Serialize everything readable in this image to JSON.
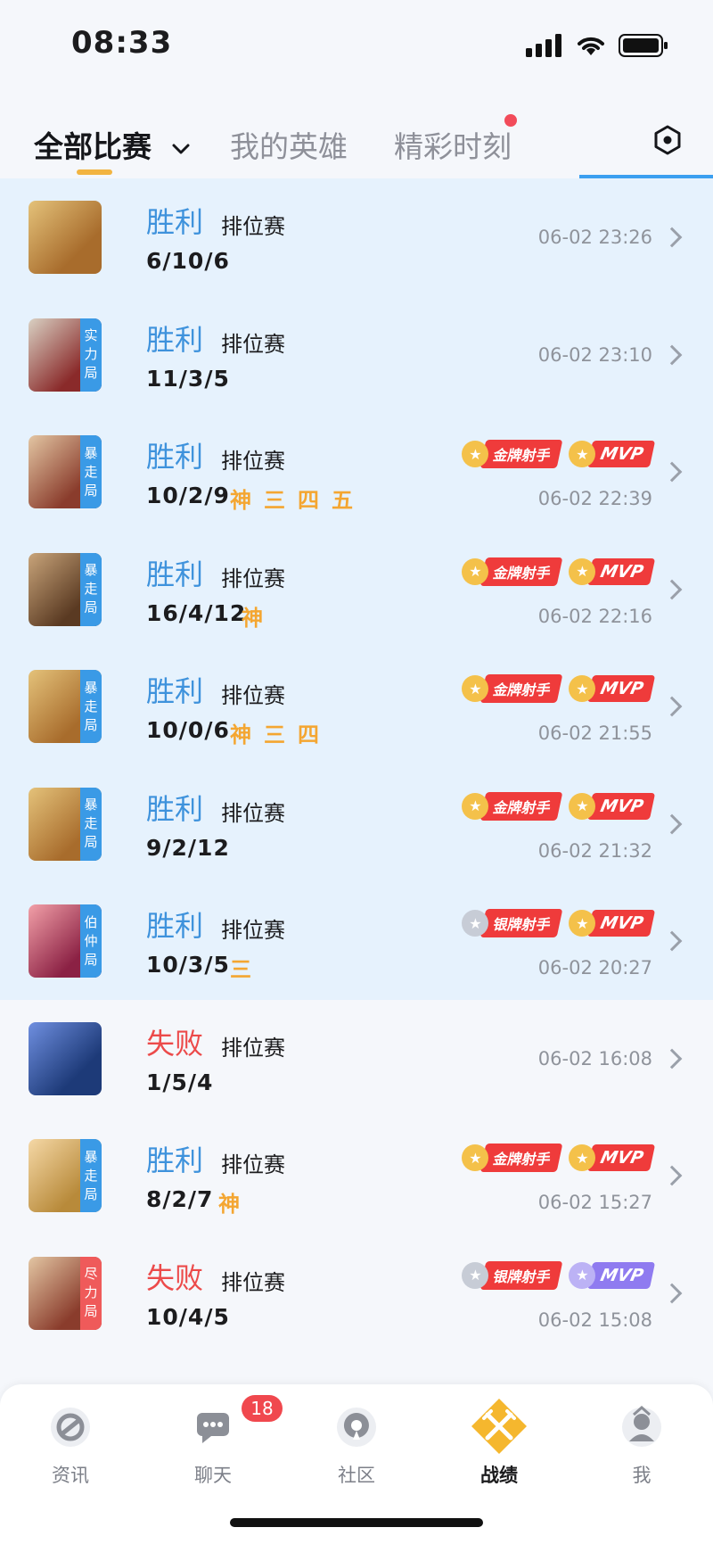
{
  "status_bar": {
    "time": "08:33"
  },
  "tabs": [
    {
      "label": "全部比赛",
      "active": true
    },
    {
      "label": "我的英雄",
      "active": false
    },
    {
      "label": "精彩时刻",
      "active": false
    }
  ],
  "matches": [
    {
      "result": "胜利",
      "outcome": "win",
      "mode": "排位赛",
      "kda": "6/10/6",
      "time": "06-02 23:26",
      "tag": "",
      "tag_color": "",
      "streaks": [],
      "badges": []
    },
    {
      "result": "胜利",
      "outcome": "win",
      "mode": "排位赛",
      "kda": "11/3/5",
      "time": "06-02 23:10",
      "tag": "实力局",
      "tag_color": "blue",
      "streaks": [],
      "badges": []
    },
    {
      "result": "胜利",
      "outcome": "win",
      "mode": "排位赛",
      "kda": "10/2/9",
      "time": "06-02 22:39",
      "tag": "暴走局",
      "tag_color": "blue",
      "streaks": [
        "神",
        "三",
        "四",
        "五"
      ],
      "badges": [
        "金牌射手",
        "MVP"
      ]
    },
    {
      "result": "胜利",
      "outcome": "win",
      "mode": "排位赛",
      "kda": "16/4/12",
      "time": "06-02 22:16",
      "tag": "暴走局",
      "tag_color": "blue",
      "streaks": [
        "神"
      ],
      "badges": [
        "金牌射手",
        "MVP"
      ]
    },
    {
      "result": "胜利",
      "outcome": "win",
      "mode": "排位赛",
      "kda": "10/0/6",
      "time": "06-02 21:55",
      "tag": "暴走局",
      "tag_color": "blue",
      "streaks": [
        "神",
        "三",
        "四"
      ],
      "badges": [
        "金牌射手",
        "MVP"
      ]
    },
    {
      "result": "胜利",
      "outcome": "win",
      "mode": "排位赛",
      "kda": "9/2/12",
      "time": "06-02 21:32",
      "tag": "暴走局",
      "tag_color": "blue",
      "streaks": [],
      "badges": [
        "金牌射手",
        "MVP"
      ]
    },
    {
      "result": "胜利",
      "outcome": "win",
      "mode": "排位赛",
      "kda": "10/3/5",
      "time": "06-02 20:27",
      "tag": "伯仲局",
      "tag_color": "blue",
      "streaks": [
        "三"
      ],
      "badges": [
        "银牌射手",
        "MVP"
      ]
    },
    {
      "result": "失败",
      "outcome": "loss",
      "mode": "排位赛",
      "kda": "1/5/4",
      "time": "06-02 16:08",
      "tag": "",
      "tag_color": "",
      "streaks": [],
      "badges": []
    },
    {
      "result": "胜利",
      "outcome": "win-plain",
      "mode": "排位赛",
      "kda": "8/2/7",
      "time": "06-02 15:27",
      "tag": "暴走局",
      "tag_color": "blue",
      "streaks": [
        "神"
      ],
      "badges": [
        "金牌射手",
        "MVP"
      ]
    },
    {
      "result": "失败",
      "outcome": "loss",
      "mode": "排位赛",
      "kda": "10/4/5",
      "time": "06-02 15:08",
      "tag": "尽力局",
      "tag_color": "red",
      "streaks": [],
      "badges": [
        "银牌射手",
        "MVP"
      ]
    }
  ],
  "colors": {
    "win": "#3e92dc",
    "loss": "#ec4a4a",
    "streak": "#f4a631",
    "accent": "#f2b441"
  },
  "bottom_nav": [
    {
      "label": "资讯",
      "icon": "news-icon",
      "active": false,
      "badge": ""
    },
    {
      "label": "聊天",
      "icon": "chat-icon",
      "active": false,
      "badge": "18"
    },
    {
      "label": "社区",
      "icon": "community-icon",
      "active": false,
      "badge": ""
    },
    {
      "label": "战绩",
      "icon": "battle-record-icon",
      "active": true,
      "badge": ""
    },
    {
      "label": "我",
      "icon": "profile-icon",
      "active": false,
      "badge": ""
    }
  ]
}
